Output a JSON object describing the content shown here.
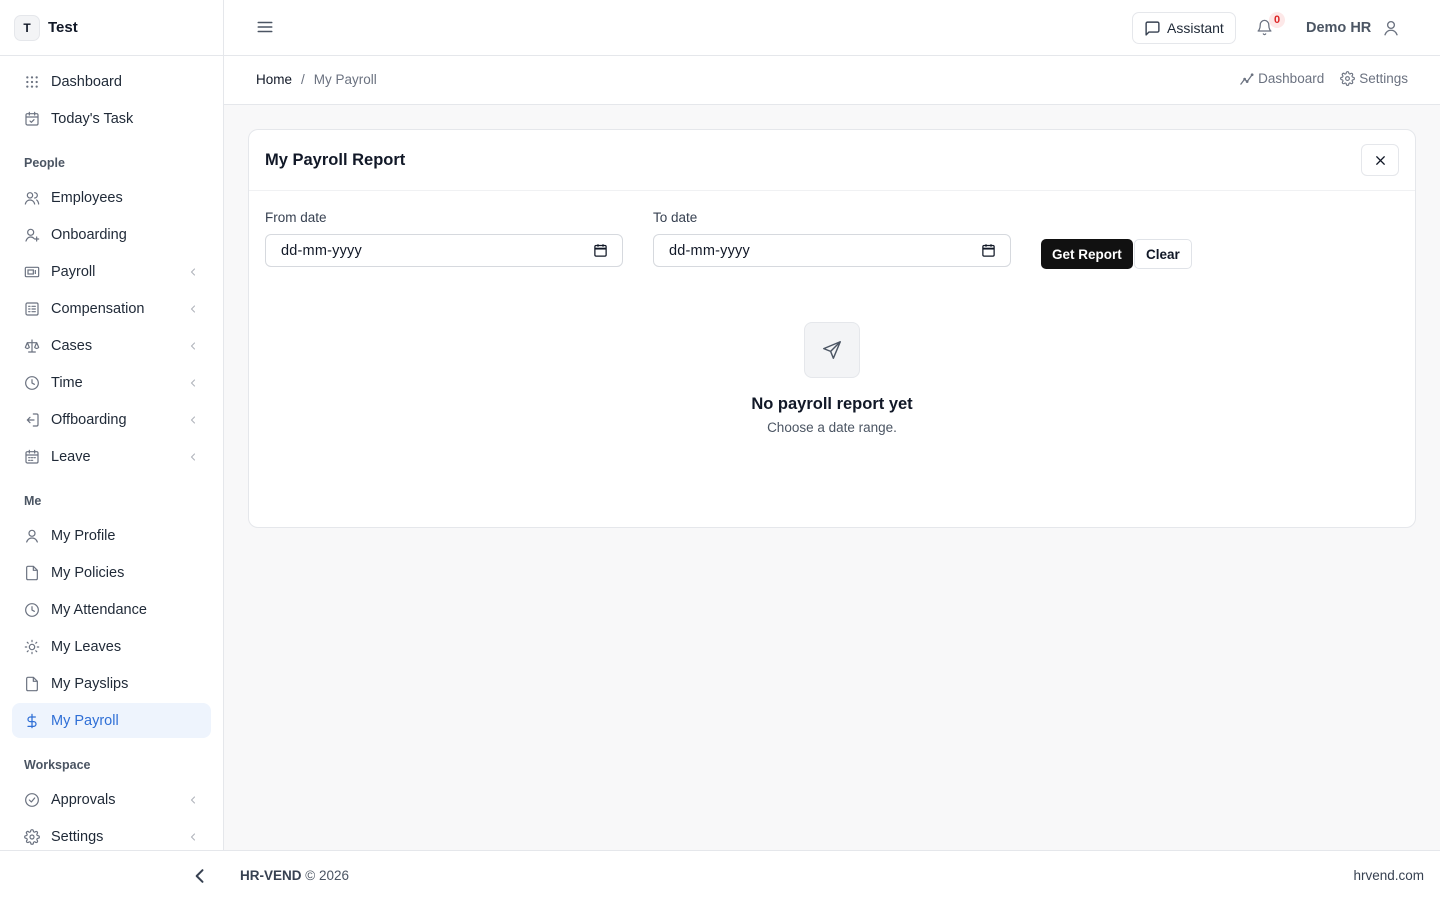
{
  "brand": {
    "initial": "T",
    "name": "Test"
  },
  "sidebar": {
    "top_items": [
      {
        "label": "Dashboard",
        "icon": "grid-icon"
      },
      {
        "label": "Today's Task",
        "icon": "calendar-check-icon"
      }
    ],
    "sections": [
      {
        "title": "People",
        "items": [
          {
            "label": "Employees",
            "icon": "users-icon",
            "has_submenu": false
          },
          {
            "label": "Onboarding",
            "icon": "user-plus-icon",
            "has_submenu": false
          },
          {
            "label": "Payroll",
            "icon": "banknote-icon",
            "has_submenu": true
          },
          {
            "label": "Compensation",
            "icon": "list-icon",
            "has_submenu": true
          },
          {
            "label": "Cases",
            "icon": "scale-icon",
            "has_submenu": true
          },
          {
            "label": "Time",
            "icon": "clock-icon",
            "has_submenu": true
          },
          {
            "label": "Offboarding",
            "icon": "log-out-icon",
            "has_submenu": true
          },
          {
            "label": "Leave",
            "icon": "calendar-icon",
            "has_submenu": true
          }
        ]
      },
      {
        "title": "Me",
        "items": [
          {
            "label": "My Profile",
            "icon": "user-icon",
            "has_submenu": false
          },
          {
            "label": "My Policies",
            "icon": "file-icon",
            "has_submenu": false
          },
          {
            "label": "My Attendance",
            "icon": "clock-icon",
            "has_submenu": false
          },
          {
            "label": "My Leaves",
            "icon": "sun-icon",
            "has_submenu": false
          },
          {
            "label": "My Payslips",
            "icon": "file-icon",
            "has_submenu": false
          },
          {
            "label": "My Payroll",
            "icon": "dollar-icon",
            "has_submenu": false,
            "active": true
          }
        ]
      },
      {
        "title": "Workspace",
        "items": [
          {
            "label": "Approvals",
            "icon": "check-circle-icon",
            "has_submenu": true
          },
          {
            "label": "Settings",
            "icon": "gear-icon",
            "has_submenu": true
          }
        ]
      }
    ]
  },
  "topbar": {
    "assistant_label": "Assistant",
    "notification_count": "0",
    "user_name": "Demo HR"
  },
  "breadcrumb": {
    "home": "Home",
    "separator": "/",
    "current": "My Payroll",
    "links": [
      {
        "label": "Dashboard",
        "icon": "chart-line-icon"
      },
      {
        "label": "Settings",
        "icon": "gear-icon"
      }
    ]
  },
  "report": {
    "title": "My Payroll Report",
    "from_label": "From date",
    "from_placeholder": "dd-mm-yyyy",
    "to_label": "To date",
    "to_placeholder": "dd-mm-yyyy",
    "get_report_label": "Get Report",
    "clear_label": "Clear",
    "empty_title": "No payroll report yet",
    "empty_subtitle": "Choose a date range."
  },
  "footer": {
    "brand": "HR-VEND",
    "copyright": "© 2026",
    "site": "hrvend.com"
  },
  "colors": {
    "accent": "#2f6fd6",
    "active_bg": "#eef4fd",
    "primary_button": "#111111",
    "badge": "#dc2626"
  }
}
